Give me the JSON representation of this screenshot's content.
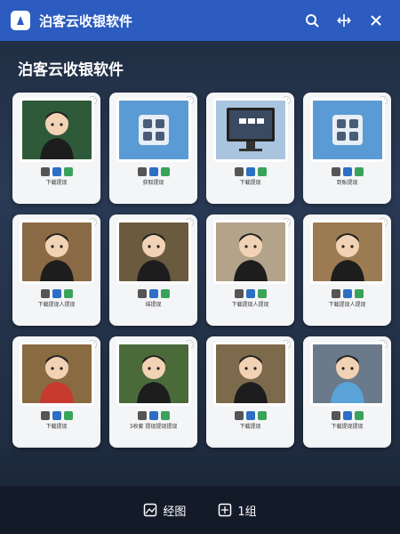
{
  "window": {
    "title": "泊客云收银软件",
    "controls": [
      "search-icon",
      "move-icon",
      "close-icon"
    ],
    "accent": "#2c5cc0"
  },
  "page": {
    "heading": "泊客云收银软件"
  },
  "cards": [
    {
      "label": "下载提现",
      "thumb": "photo-girl",
      "bg": "#2f5a3a"
    },
    {
      "label": "获取提现",
      "thumb": "app-blue",
      "bg": "#5b9bd5"
    },
    {
      "label": "下载提现",
      "thumb": "monitor",
      "bg": "#a9c4df"
    },
    {
      "label": "到账提现",
      "thumb": "app-blue",
      "bg": "#5b9bd5"
    },
    {
      "label": "下载提现人提现",
      "thumb": "photo-girl-2",
      "bg": "#8a6a44"
    },
    {
      "label": "结提现",
      "thumb": "photo-girl-3",
      "bg": "#6a5a3e"
    },
    {
      "label": "下载提现人提现",
      "thumb": "cartoon-boy-bowl",
      "bg": "#b3a38a"
    },
    {
      "label": "下载提现人提现",
      "thumb": "photo-girl-4",
      "bg": "#9c7b52"
    },
    {
      "label": "下载提现",
      "thumb": "cartoon-boy-red",
      "bg": "#8a6a40"
    },
    {
      "label": "3收套 提现提现提现",
      "thumb": "cartoon-boy-green",
      "bg": "#4a6a3a"
    },
    {
      "label": "下载提现",
      "thumb": "cartoon-elder",
      "bg": "#7d6a4c"
    },
    {
      "label": "下载提现提现",
      "thumb": "cartoon-boy-blue",
      "bg": "#6b7a8a"
    }
  ],
  "bottom_bar": {
    "items": [
      {
        "label": "经图",
        "icon": "image-icon"
      },
      {
        "label": "1组",
        "icon": "group-icon"
      }
    ]
  }
}
